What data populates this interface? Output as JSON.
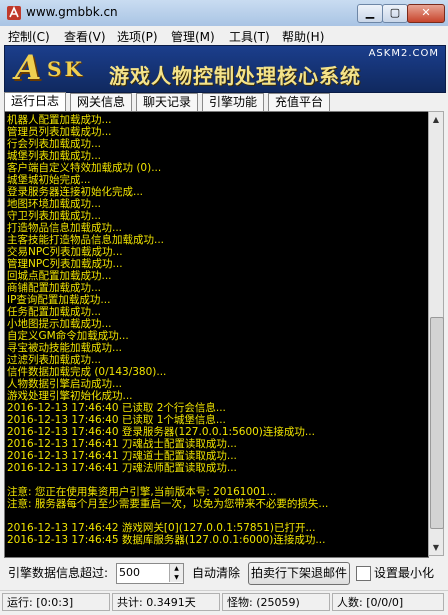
{
  "window": {
    "title": "www.gmbbk.cn"
  },
  "menu": [
    "控制(C)",
    "查看(V)",
    "选项(P)",
    "管理(M)",
    "工具(T)",
    "帮助(H)"
  ],
  "banner": {
    "logo": "A",
    "brand": "SK",
    "slogan": "游戏人物控制处理核心系统",
    "site": "ASKM2.COM"
  },
  "tabs": [
    "运行日志",
    "网关信息",
    "聊天记录",
    "引擎功能",
    "充值平台"
  ],
  "log": [
    "机器人配置加载成功...",
    "管理员列表加载成功...",
    "行会列表加载成功...",
    "城堡列表加载成功...",
    "客户端自定义特效加载成功 (0)...",
    "城堡城初始完成...",
    "登录服务器连接初始化完成...",
    "地图环境加载成功...",
    "守卫列表加载成功...",
    "打造物品信息加载成功...",
    "主客技能打造物品信息加载成功...",
    "交易NPC列表加载成功...",
    "管理NPC列表加载成功...",
    "回城点配置加载成功...",
    "商铺配置加载成功...",
    "IP查询配置加载成功...",
    "任务配置加载成功...",
    "小地图提示加载成功...",
    "自定义GM命令加载成功...",
    "寻宝被动技能加载成功...",
    "过滤列表加载成功...",
    "信件数据加载完成 (0/143/380)...",
    "人物数据引擎启动成功...",
    "游戏处理引擎初始化成功...",
    "2016-12-13 17:46:40 已读取 2个行会信息...",
    "2016-12-13 17:46:40 已读取 1个城堡信息...",
    "2016-12-13 17:46:40 登录服务器(127.0.0.1:5600)连接成功...",
    "2016-12-13 17:46:41 刀魂战士配置读取成功...",
    "2016-12-13 17:46:41 刀魂道士配置读取成功...",
    "2016-12-13 17:46:41 刀魂法师配置读取成功...",
    "",
    "注意: 您正在使用集资用户引擎,当前版本号: 20161001...",
    "注意: 服务器每个月至少需要重启一次，以免为您带来不必要的损失...",
    "",
    "2016-12-13 17:46:42 游戏网关[0](127.0.0.1:57851)已打开...",
    "2016-12-13 17:46:45 数据库服务器(127.0.0.1:6000)连接成功..."
  ],
  "controls": {
    "engine_label": "引擎数据信息超过:",
    "engine_value": "500",
    "auto_clear": "自动清除",
    "archive_button": "拍卖行下架退邮件",
    "minimize_label": "设置最小化"
  },
  "status": {
    "run": "运行: [0:0:3]",
    "total": "共计: 0.3491天",
    "monsters": "怪物: (25059)",
    "players": "人数: [0/0/0]"
  },
  "colors": {
    "log_text": "#f0e400",
    "console_bg": "#000000",
    "banner_bg": "#1b3e8c"
  }
}
